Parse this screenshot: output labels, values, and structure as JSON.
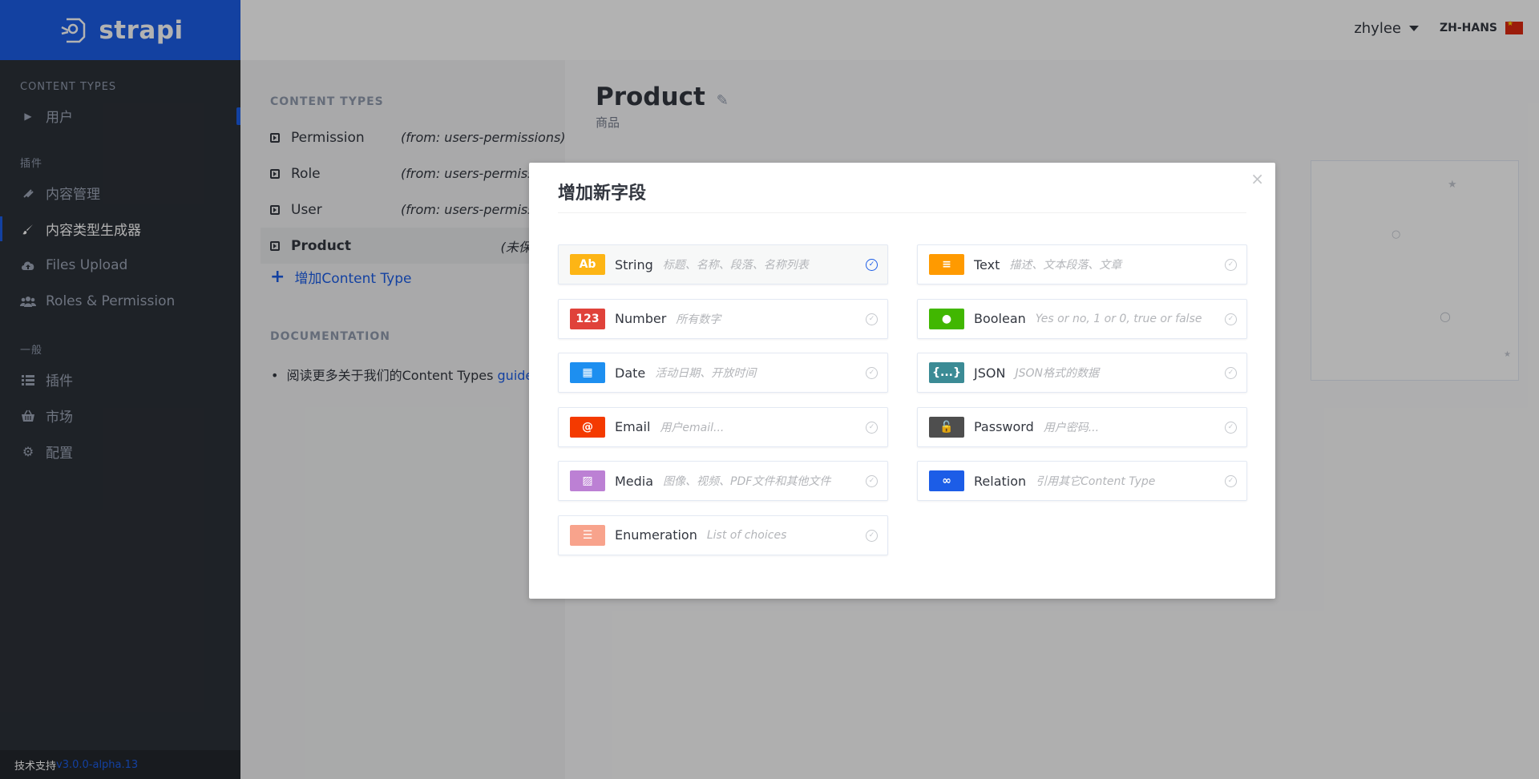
{
  "app": {
    "logo_text": "strapi"
  },
  "header": {
    "username": "zhylee",
    "language": "ZH-HANS"
  },
  "sidebar": {
    "content_types_heading": "CONTENT TYPES",
    "content_types": [
      {
        "label": "用户"
      }
    ],
    "plugins_heading": "插件",
    "plugins": [
      {
        "label": "内容管理",
        "icon": "plug-icon"
      },
      {
        "label": "内容类型生成器",
        "icon": "brush-icon"
      },
      {
        "label": "Files Upload",
        "icon": "cloud-upload-icon"
      },
      {
        "label": "Roles & Permission",
        "icon": "users-icon"
      }
    ],
    "general_heading": "一般",
    "general": [
      {
        "label": "插件",
        "icon": "list-icon"
      },
      {
        "label": "市场",
        "icon": "basket-icon"
      },
      {
        "label": "配置",
        "icon": "gear-icon"
      }
    ],
    "footer": {
      "label": "技术支持",
      "version": "v3.0.0-alpha.13"
    }
  },
  "ct_panel": {
    "heading": "CONTENT TYPES",
    "items": [
      {
        "name": "Permission",
        "from": "(from: users-permissions)"
      },
      {
        "name": "Role",
        "from": "(from: users-permissions)"
      },
      {
        "name": "User",
        "from": "(from: users-permissions)"
      },
      {
        "name": "Product",
        "from": "(未保存)"
      }
    ],
    "add_label": "增加Content Type",
    "doc_heading": "DOCUMENTATION",
    "doc_text": "阅读更多关于我们的Content Types",
    "doc_link": "guide."
  },
  "main": {
    "title": "Product",
    "subtitle": "商品"
  },
  "modal": {
    "title": "增加新字段",
    "fields": [
      {
        "badge": "Ab",
        "name": "String",
        "desc": "标题、名称、段落、名称列表",
        "color": "#fdb515",
        "selected": true
      },
      {
        "badge": "≡",
        "name": "Text",
        "desc": "描述、文本段落、文章",
        "color": "#ff9a00",
        "selected": false
      },
      {
        "badge": "123",
        "name": "Number",
        "desc": "所有数字",
        "color": "#e0423a",
        "selected": false
      },
      {
        "badge": "●",
        "name": "Boolean",
        "desc": "Yes or no, 1 or 0, true or false",
        "color": "#41b701",
        "selected": false
      },
      {
        "badge": "▦",
        "name": "Date",
        "desc": "活动日期、开放时间",
        "color": "#1d8ff0",
        "selected": false
      },
      {
        "badge": "{...}",
        "name": "JSON",
        "desc": "JSON格式的数据",
        "color": "#3b8b95",
        "selected": false
      },
      {
        "badge": "@",
        "name": "Email",
        "desc": "用户email...",
        "color": "#f43a00",
        "selected": false
      },
      {
        "badge": "🔓",
        "name": "Password",
        "desc": "用户密码...",
        "color": "#4e4e4e",
        "selected": false
      },
      {
        "badge": "▨",
        "name": "Media",
        "desc": "图像、视频、PDF文件和其他文件",
        "color": "#bc80d4",
        "selected": false
      },
      {
        "badge": "∞",
        "name": "Relation",
        "desc": "引用其它Content Type",
        "color": "#1c5de7",
        "selected": false
      },
      {
        "badge": "☰",
        "name": "Enumeration",
        "desc": "List of choices",
        "color": "#f8a38c",
        "selected": false
      }
    ]
  }
}
